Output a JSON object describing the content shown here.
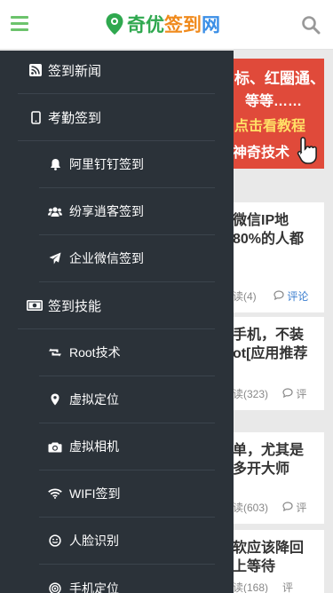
{
  "header": {
    "logo_part1": "奇优",
    "logo_part2": "签到",
    "logo_part3": "网"
  },
  "banner": {
    "line1": "标、红圈通、",
    "line2": "等等……",
    "line3": "点击看教程",
    "line4": "神奇技术"
  },
  "cards": [
    {
      "title_line1": "微信IP地",
      "title_line2": "80%的人都",
      "views": "读(4)",
      "comments": "评论",
      "comments_link": true
    },
    {
      "title_line1": "手机，不装",
      "title_line2": "ot[应用推荐",
      "views": "读(323)",
      "comments": "评",
      "comments_link": false
    },
    {
      "title_line1": "单，尤其是",
      "title_line2": "多开大师",
      "views": "读(603)",
      "comments": "评",
      "comments_link": false
    },
    {
      "title_line1": "软应该降回",
      "title_line2": "上等待",
      "views": "读(168)",
      "comments": "评",
      "comments_link": false
    }
  ],
  "menu": {
    "items": [
      {
        "label": "签到新闻",
        "icon": "rss-icon"
      },
      {
        "label": "考勤签到",
        "icon": "mobile-icon"
      },
      {
        "label": "阿里钉钉签到",
        "icon": "bell-icon"
      },
      {
        "label": "纷享逍客签到",
        "icon": "users-icon"
      },
      {
        "label": "企业微信签到",
        "icon": "paper-plane-icon"
      },
      {
        "label": "签到技能",
        "icon": "money-icon"
      },
      {
        "label": "Root技术",
        "icon": "retweet-icon"
      },
      {
        "label": "虚拟定位",
        "icon": "map-marker-icon"
      },
      {
        "label": "虚拟相机",
        "icon": "camera-icon"
      },
      {
        "label": "WIFI签到",
        "icon": "wifi-icon"
      },
      {
        "label": "人脸识别",
        "icon": "smile-icon"
      },
      {
        "label": "手机定位",
        "icon": "target-icon"
      }
    ]
  },
  "colors": {
    "drawer_bg": "#2b3239",
    "hamburger": "#6cc36c",
    "banner_bg": "#e04a3a",
    "link": "#3a7ecf"
  }
}
